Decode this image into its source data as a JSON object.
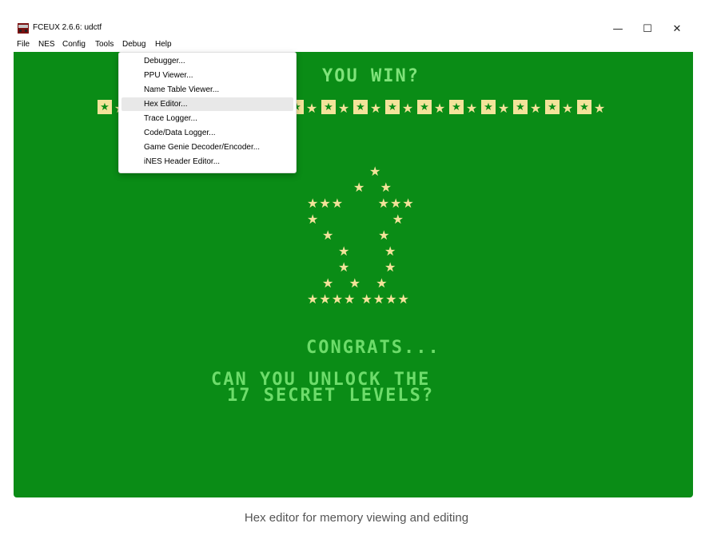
{
  "window": {
    "title": "FCEUX 2.6.6: udctf",
    "controls": {
      "minimize": "—",
      "maximize": "☐",
      "close": "✕"
    }
  },
  "menubar": {
    "items": [
      "File",
      "NES",
      "Config",
      "Tools",
      "Debug",
      "Help"
    ],
    "active": "Debug"
  },
  "debug_menu": {
    "items": [
      "Debugger...",
      "PPU Viewer...",
      "Name Table Viewer...",
      "Hex Editor...",
      "Trace Logger...",
      "Code/Data Logger...",
      "Game Genie Decoder/Encoder...",
      "iNES Header Editor..."
    ],
    "highlighted": "Hex Editor..."
  },
  "game": {
    "heading": "YOU WIN?",
    "congrats": "CONGRATS...",
    "line1": "CAN YOU UNLOCK THE",
    "line2": "17 SECRET LEVELS?",
    "colors": {
      "background": "#0a8c16",
      "text": "#6ddc6a",
      "stars": "#f3e39a"
    }
  },
  "caption": "Hex editor for memory viewing and editing"
}
